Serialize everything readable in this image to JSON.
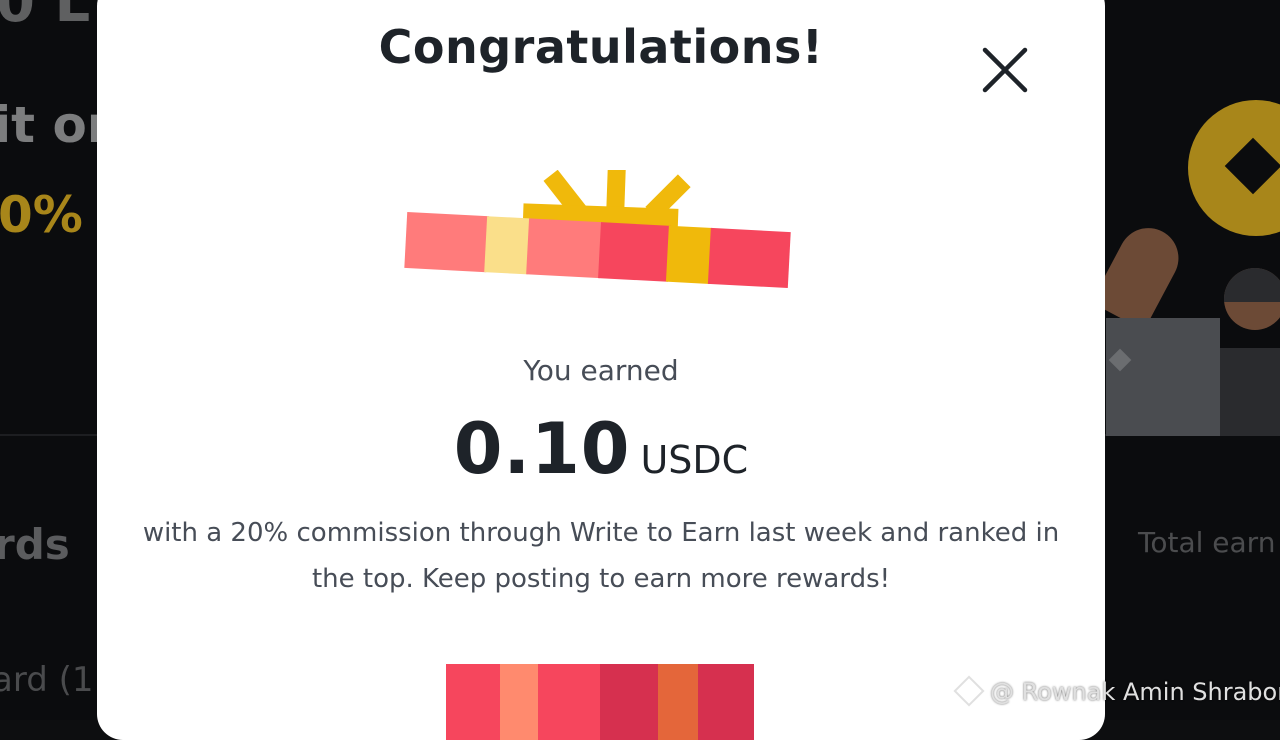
{
  "background": {
    "top_text": "0 L",
    "line2": "it or",
    "line3": "0%",
    "line4": "rds",
    "line5": "ard (1",
    "right_label": "Total earn"
  },
  "modal": {
    "title": "Congratulations!",
    "close_icon": "close-icon",
    "gift_icon": "gift-icon",
    "earned_label": "You earned",
    "amount": "0.10",
    "unit": "USDC",
    "description": "with a 20% commission through Write to Earn last week and ranked in the top. Keep posting to earn more rewards!"
  },
  "watermark": {
    "text": "@ Rownak Amin Shrabon",
    "icon": "binance-square-icon"
  },
  "colors": {
    "accent_gold": "#F0B90B",
    "coral": "#F6465D",
    "text_dark": "#1E2329"
  }
}
